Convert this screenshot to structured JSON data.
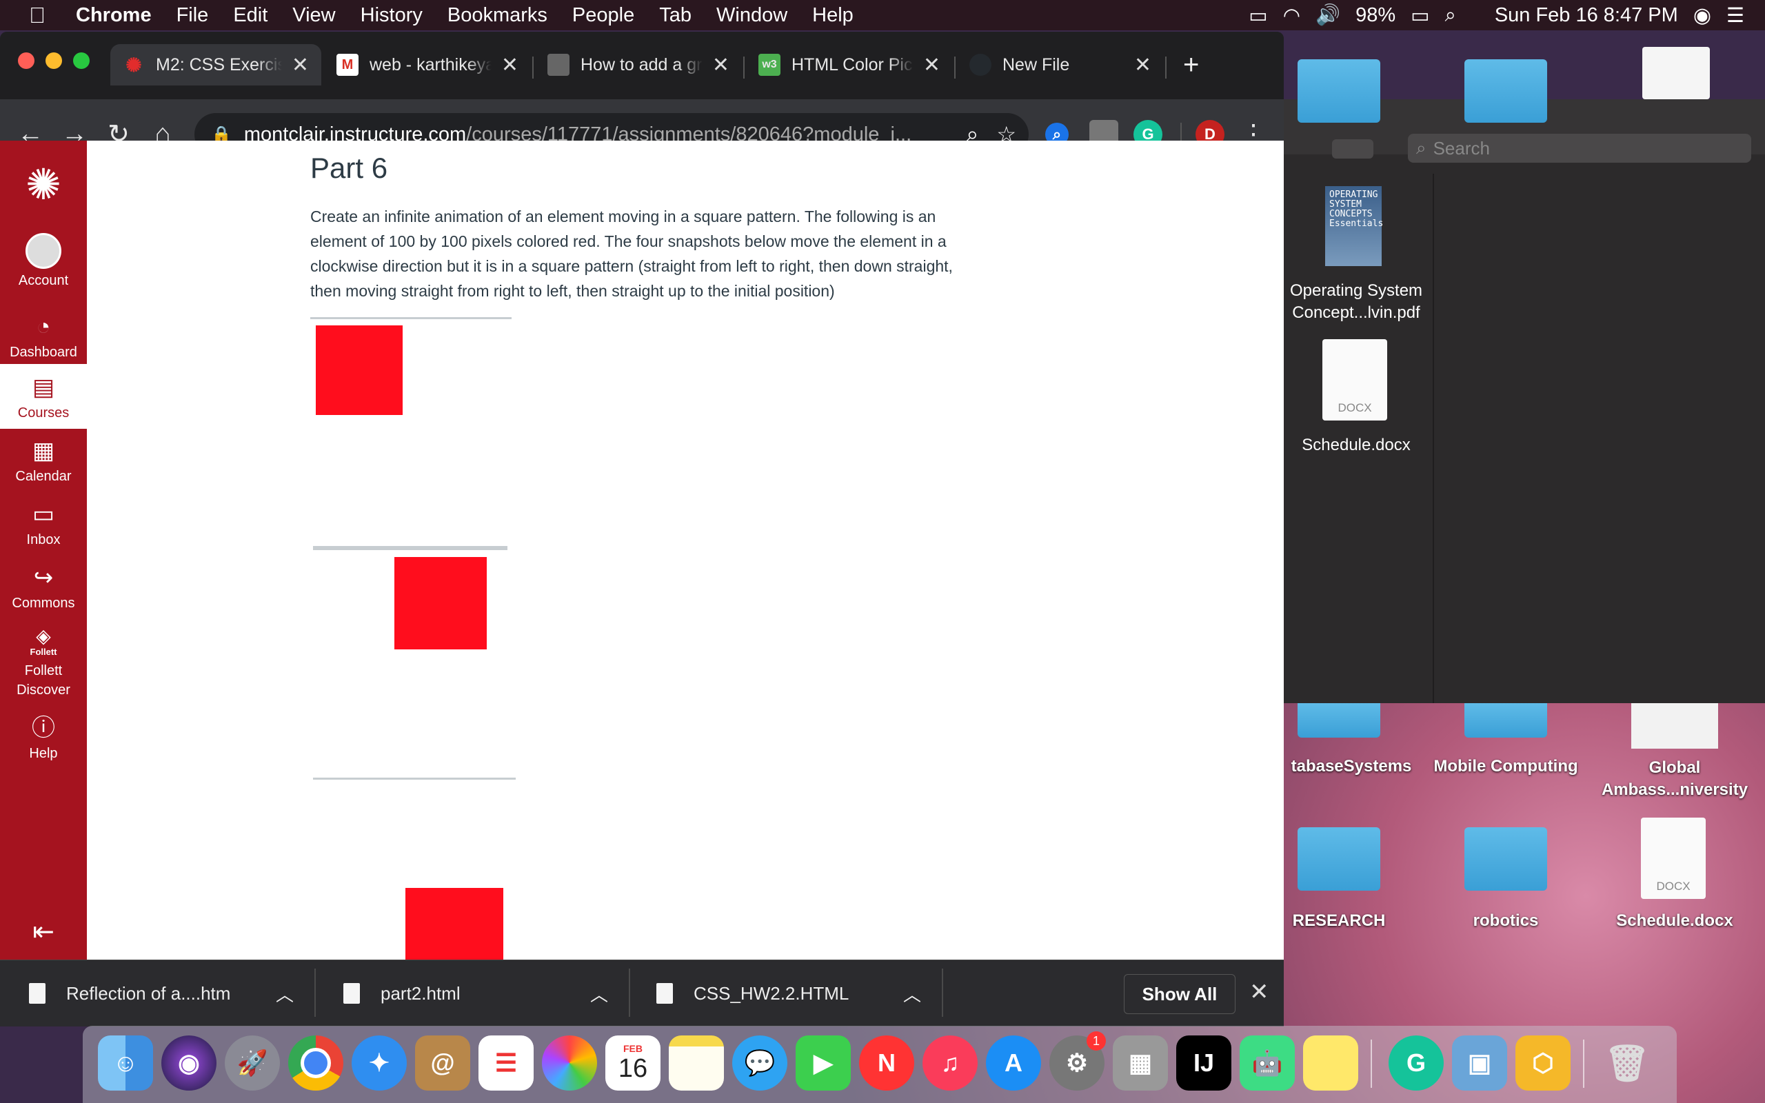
{
  "menubar": {
    "app": "Chrome",
    "items": [
      "File",
      "Edit",
      "View",
      "History",
      "Bookmarks",
      "People",
      "Tab",
      "Window",
      "Help"
    ],
    "battery": "98%",
    "datetime": "Sun Feb 16  8:47 PM"
  },
  "tabs": [
    {
      "label": "M2: CSS Exercis",
      "color": "#e22c2c"
    },
    {
      "label": "web - karthikeya",
      "color": "#d93025"
    },
    {
      "label": "How to add a gr",
      "color": "#666666"
    },
    {
      "label": "HTML Color Pic",
      "color": "#4caf50"
    },
    {
      "label": "New File",
      "color": "#24292e"
    }
  ],
  "toolbar": {
    "url_host": "montclair.instructure.com",
    "url_path": "/courses/117771/assignments/820646?module_i...",
    "profile_initial": "D"
  },
  "canvas_nav": [
    {
      "label": "Account",
      "icon": "account-icon"
    },
    {
      "label": "Dashboard",
      "icon": "dashboard-icon"
    },
    {
      "label": "Courses",
      "icon": "courses-icon"
    },
    {
      "label": "Calendar",
      "icon": "calendar-icon"
    },
    {
      "label": "Inbox",
      "icon": "inbox-icon"
    },
    {
      "label": "Commons",
      "icon": "commons-icon"
    },
    {
      "label": "Follett Discover",
      "icon": "follett-icon"
    },
    {
      "label": "Help",
      "icon": "help-icon"
    }
  ],
  "follett_small": "Follett",
  "page": {
    "heading": "Part 6",
    "paragraph": "Create an infinite animation of an element moving in a square pattern. The following is an element of 100 by 100 pixels colored red. The four snapshots below move the element in a clockwise direction but it is in a square pattern (straight from left to right, then down straight, then moving straight from right to left, then straight up to the initial position)"
  },
  "downloads": [
    {
      "name": "Reflection of a....htm"
    },
    {
      "name": "part2.html"
    },
    {
      "name": "CSS_HW2.2.HTML"
    }
  ],
  "downloads_show_all": "Show All",
  "finder": {
    "search_placeholder": "Search",
    "files": [
      {
        "name": "Operating System Concept...lvin.pdf",
        "cover_text": "OPERATING SYSTEM CONCEPTS Essentials"
      },
      {
        "name": "Schedule.docx",
        "type_badge": "DOCX"
      }
    ]
  },
  "desktop": {
    "items": [
      {
        "label": "tabaseSystems"
      },
      {
        "label": "Mobile Computing"
      },
      {
        "label": "Global Ambass...niversity"
      },
      {
        "label": "RESEARCH"
      },
      {
        "label": "robotics"
      },
      {
        "label": "Schedule.docx",
        "type_badge": "DOCX"
      }
    ]
  },
  "dock": {
    "calendar_month": "FEB",
    "calendar_day": "16",
    "badge": "1"
  }
}
